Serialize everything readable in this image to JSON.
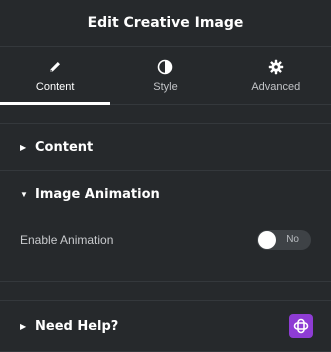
{
  "header": {
    "title": "Edit Creative Image"
  },
  "tabs": [
    {
      "label": "Content",
      "icon": "pencil-icon",
      "active": true
    },
    {
      "label": "Style",
      "icon": "half-circle-icon",
      "active": false
    },
    {
      "label": "Advanced",
      "icon": "gear-icon",
      "active": false
    }
  ],
  "sections": {
    "content": {
      "title": "Content",
      "icon": "caret-right-icon"
    },
    "image_animation": {
      "title": "Image Animation",
      "icon": "caret-down-icon",
      "enable_animation": {
        "label": "Enable Animation",
        "toggle_text": "No",
        "on": false
      }
    },
    "need_help": {
      "title": "Need Help?",
      "icon": "caret-right-icon",
      "badge_icon": "help-plugin-icon"
    }
  },
  "colors": {
    "background": "#26292c",
    "badge": "#8e3cd4",
    "divider": "#34383c"
  }
}
